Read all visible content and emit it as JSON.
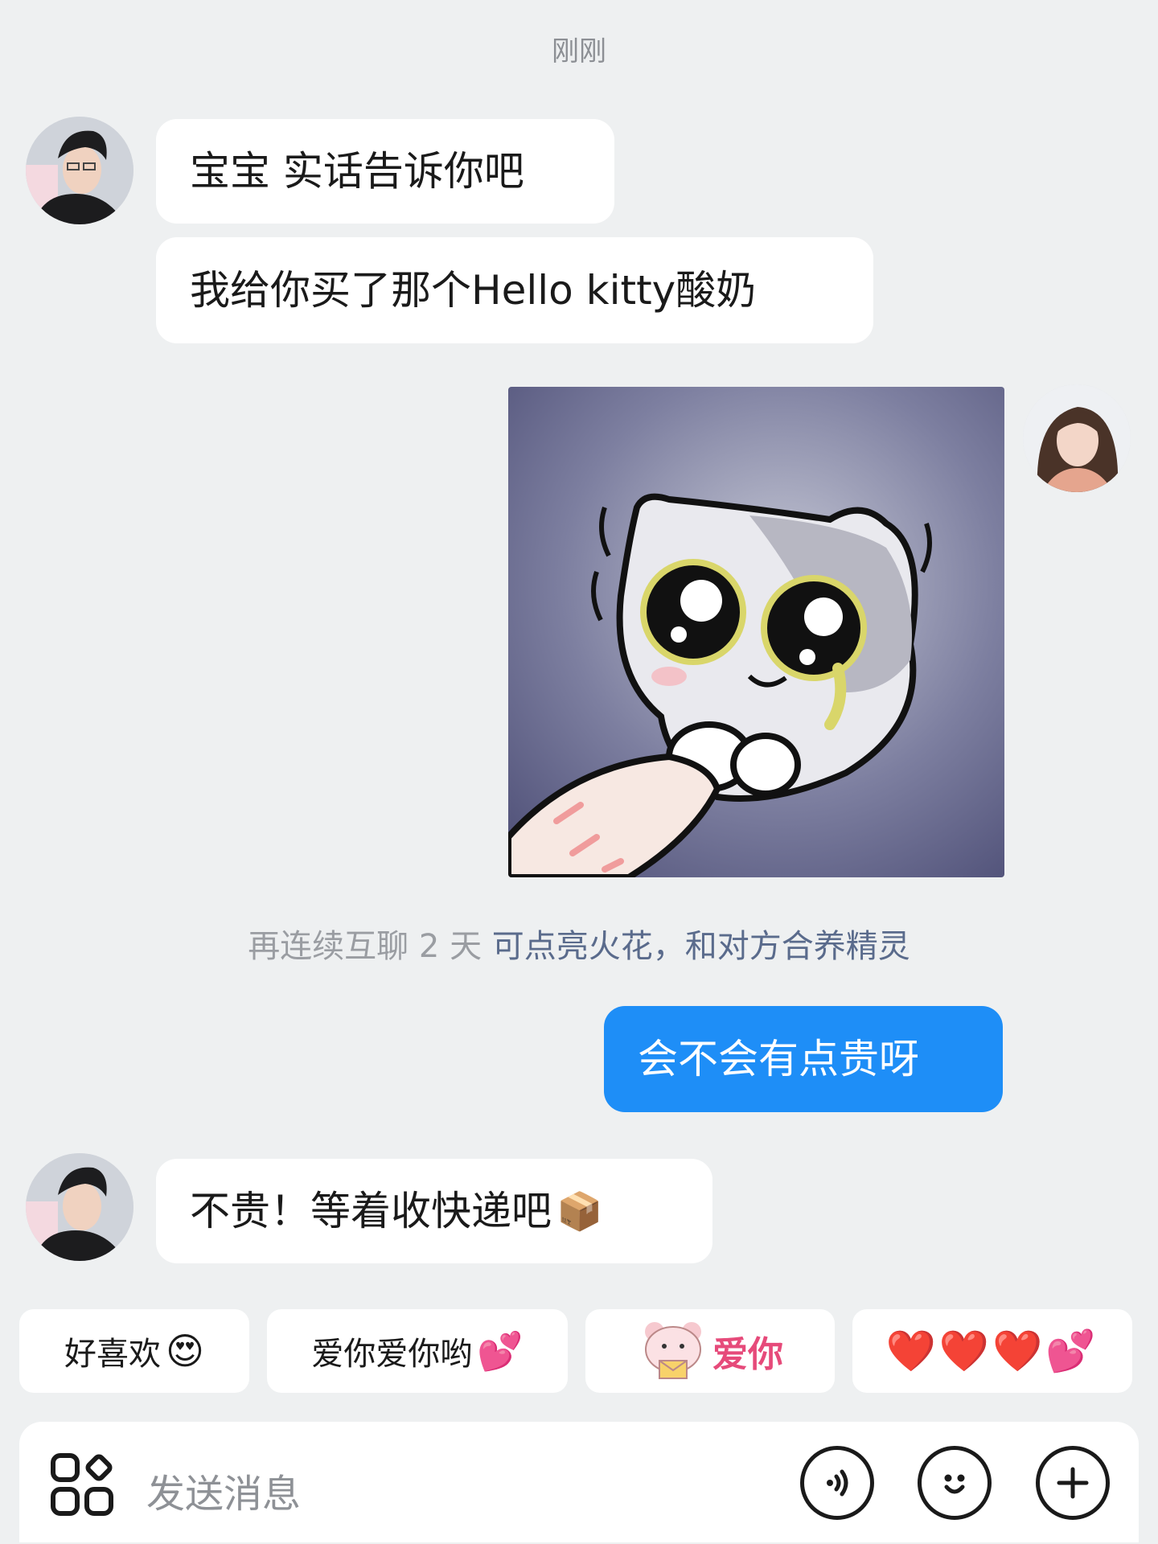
{
  "chat": {
    "timestamp": "刚刚",
    "messages": [
      {
        "from": "contact",
        "text": "宝宝 实话告诉你吧"
      },
      {
        "from": "contact",
        "text": "我给你买了那个Hello kitty酸奶"
      },
      {
        "from": "me",
        "type": "sticker",
        "sticker_icon": "crying-cat-sticker-icon"
      },
      {
        "from": "me",
        "text": "会不会有点贵呀"
      },
      {
        "from": "contact",
        "text": "不贵！等着收快递吧"
      }
    ],
    "package_emoji": "📦"
  },
  "hint": {
    "prefix": "再连续互聊 2 天",
    "link": "可点亮火花，和对方合养精灵"
  },
  "quick_replies": [
    {
      "text": "好喜欢",
      "emoji": "😍"
    },
    {
      "text": "爱你爱你哟",
      "emoji": "💕"
    },
    {
      "text": "爱你",
      "sticker_icon": "bear-love-sticker-icon"
    },
    {
      "text": "",
      "emoji": "❤️❤️❤️💕"
    }
  ],
  "input": {
    "placeholder": "发送消息",
    "icons": [
      "apps-icon",
      "voice-icon",
      "emoji-icon",
      "plus-icon"
    ]
  },
  "colors": {
    "background": "#eef0f1",
    "outgoing_bubble": "#1e8ef7",
    "incoming_bubble": "#ffffff"
  }
}
